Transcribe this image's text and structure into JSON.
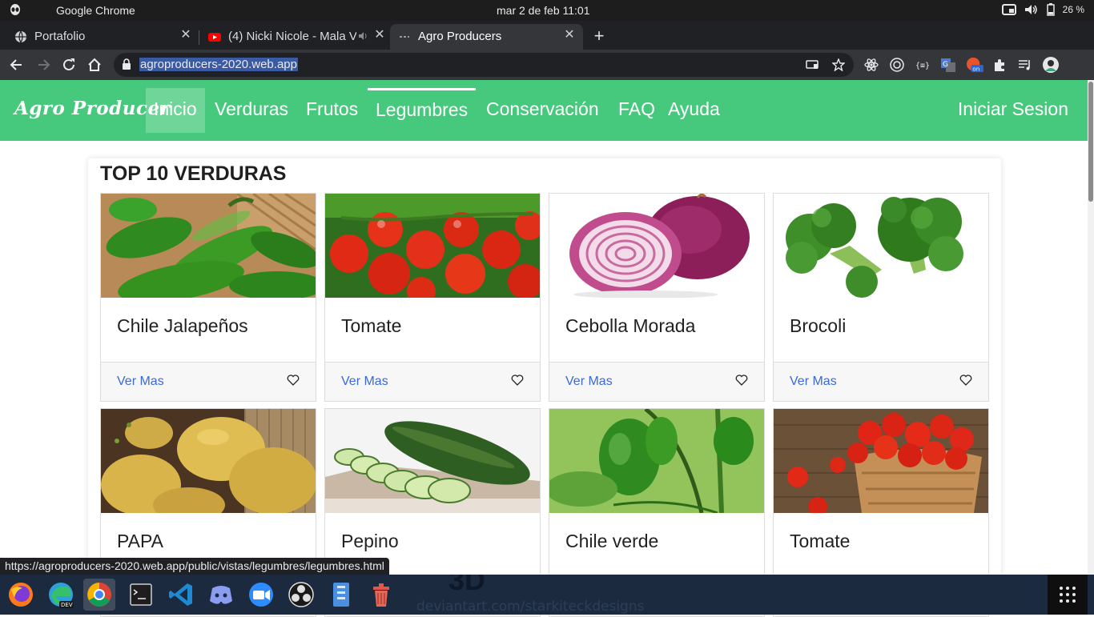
{
  "os": {
    "app_name": "Google Chrome",
    "clock": "mar  2 de feb  11:01",
    "battery": "26 %"
  },
  "browser": {
    "tabs": [
      {
        "title": "Portafolio",
        "icon": "globe-icon",
        "active": false
      },
      {
        "title": "(4) Nicki Nicole - Mala V",
        "icon": "youtube-icon",
        "active": false
      },
      {
        "title": "Agro Producers",
        "icon": "page-icon",
        "active": true
      }
    ],
    "url": "agroproducers-2020.web.app",
    "status_link": "https://agroproducers-2020.web.app/public/vistas/legumbres/legumbres.html"
  },
  "site": {
    "brand": "Agro Producer",
    "nav": [
      "Inicio",
      "Verduras",
      "Frutos",
      "Legumbres",
      "Conservación",
      "FAQ",
      "Ayuda"
    ],
    "login": "Iniciar Sesion",
    "section_title": "TOP 10 VERDURAS",
    "cards": [
      {
        "name": "Chile Jalapeños",
        "link": "Ver Mas"
      },
      {
        "name": "Tomate",
        "link": "Ver Mas"
      },
      {
        "name": "Cebolla Morada",
        "link": "Ver Mas"
      },
      {
        "name": "Brocoli",
        "link": "Ver Mas"
      },
      {
        "name": "PAPA"
      },
      {
        "name": "Pepino"
      },
      {
        "name": "Chile verde"
      },
      {
        "name": "Tomate"
      }
    ]
  },
  "colors": {
    "nav_green": "#47c97d",
    "link_blue": "#3b6ad6",
    "chrome_dark": "#202124"
  },
  "dock": {
    "apps": [
      "firefox-icon",
      "edge-dev-icon",
      "chrome-icon",
      "terminal-icon",
      "vscode-icon",
      "discord-icon",
      "zoom-icon",
      "obs-icon",
      "file-manager-icon",
      "trash-icon"
    ],
    "wallpaper_text": "deviantart.com/starkiteckdesigns"
  }
}
